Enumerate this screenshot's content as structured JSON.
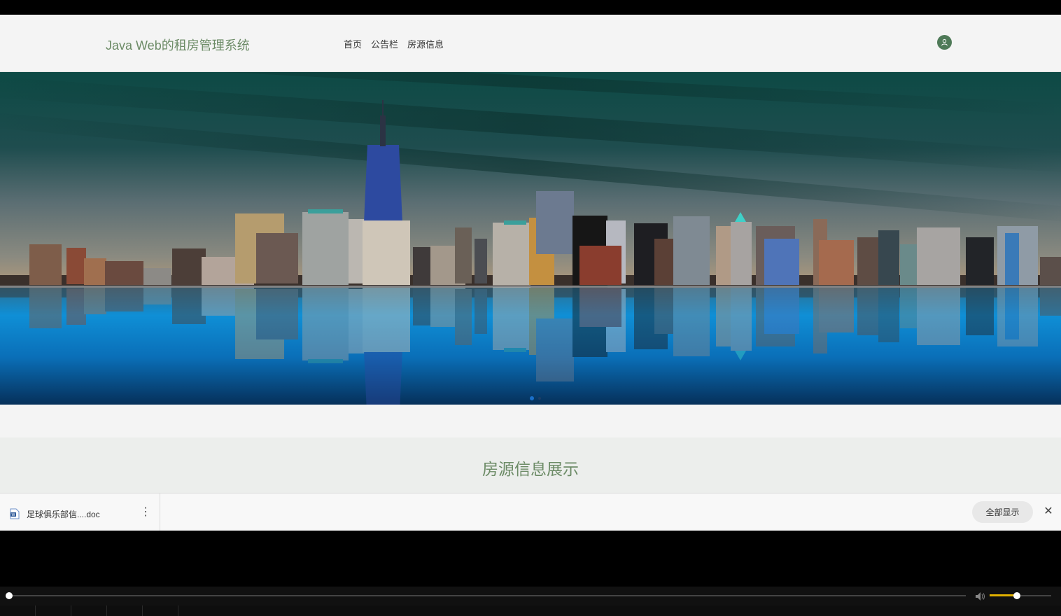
{
  "header": {
    "site_title": "Java Web的租房管理系统",
    "nav": [
      "首页",
      "公告栏",
      "房源信息"
    ],
    "avatar_icon": "user-icon"
  },
  "banner": {
    "carousel": {
      "slide_count": 2,
      "active_index": 0
    }
  },
  "section": {
    "title": "房源信息展示"
  },
  "download_bar": {
    "file_name": "足球俱乐部信....doc",
    "file_icon": "word-doc-icon",
    "menu_icon": "more-vertical-icon",
    "show_all_label": "全部显示",
    "close_icon": "close-icon"
  },
  "player": {
    "progress": 0.0,
    "volume": 0.45,
    "volume_icon": "speaker-icon"
  },
  "colors": {
    "brand_green": "#6c8b66",
    "avatar_green": "#4f7a58",
    "dot_active": "#1a6fc9",
    "volume_fill": "#e0b000"
  }
}
